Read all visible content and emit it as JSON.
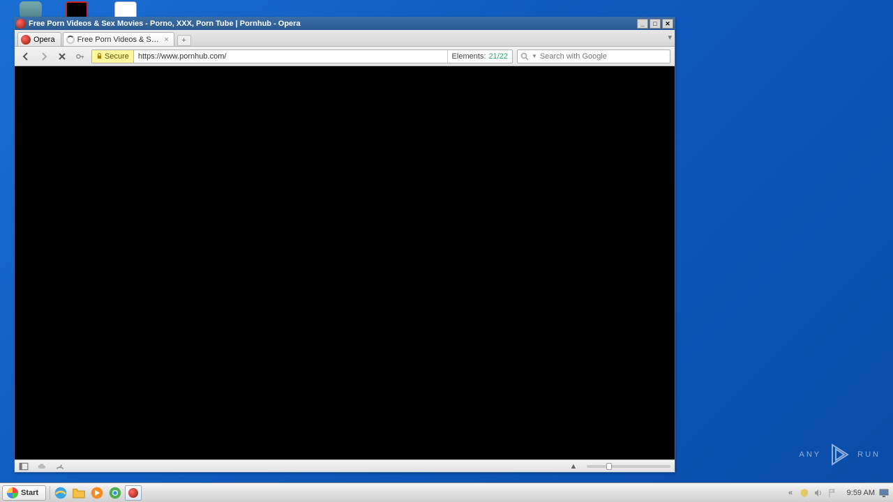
{
  "window": {
    "title": "Free Porn Videos & Sex Movies - Porno, XXX, Porn Tube | Pornhub - Opera"
  },
  "tabs": {
    "speed_dial_label": "Opera",
    "page_tab_label": "Free Porn Videos & Sex ..."
  },
  "address_bar": {
    "secure_label": "Secure",
    "url": "https://www.pornhub.com/",
    "elements_label": "Elements:",
    "elements_count": "21/22"
  },
  "search": {
    "placeholder": "Search with Google"
  },
  "status": {
    "scroll_up_glyph": "▲"
  },
  "taskbar": {
    "start_label": "Start",
    "clock": "9:59 AM",
    "tray_chevron": "«"
  },
  "watermark": {
    "brand_a": "ANY",
    "brand_b": "RUN"
  }
}
